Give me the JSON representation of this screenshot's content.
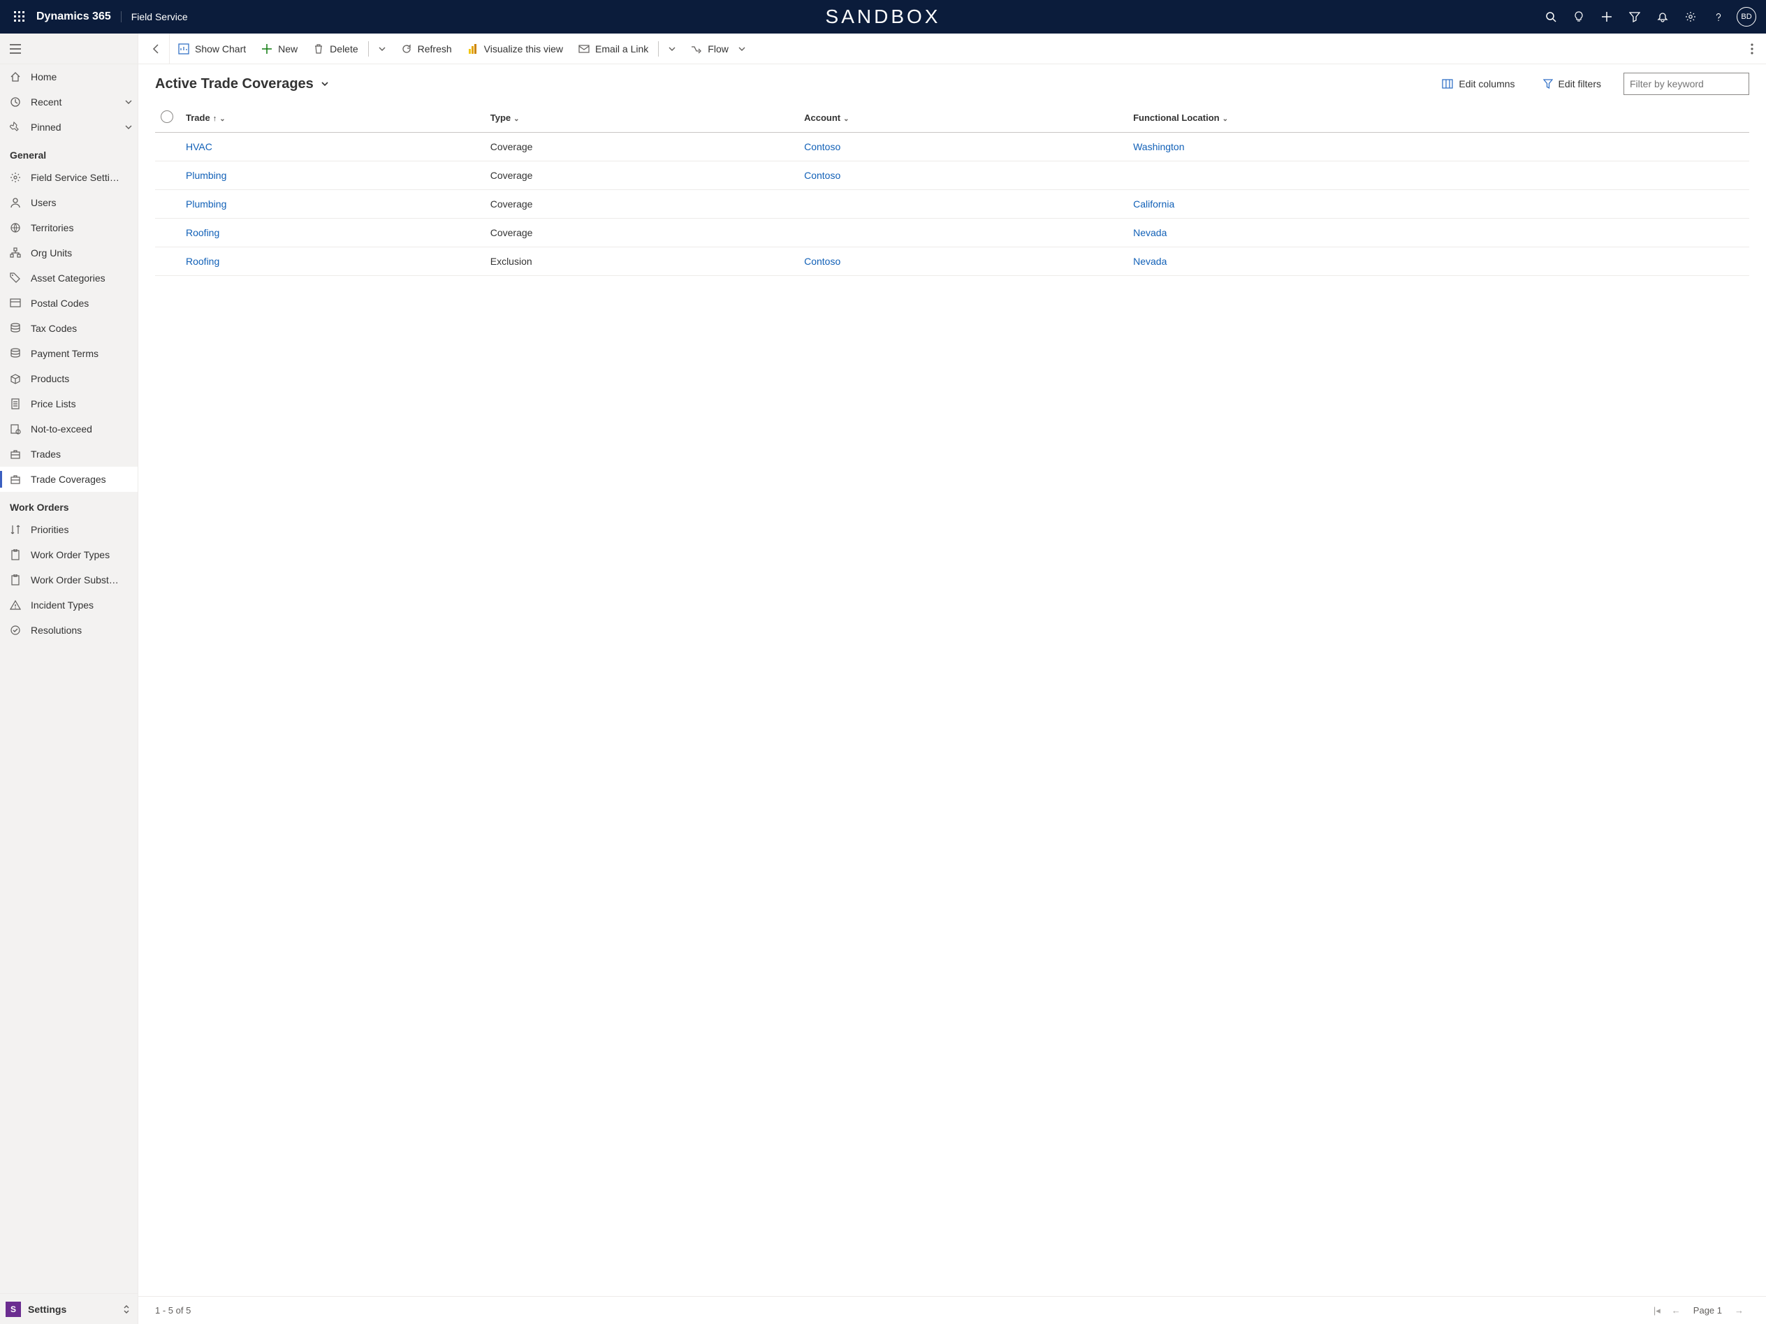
{
  "topnav": {
    "brand": "Dynamics 365",
    "app": "Field Service",
    "env": "SANDBOX",
    "avatar": "BD"
  },
  "sidebar": {
    "pinned_items": [
      {
        "id": "home",
        "icon": "home",
        "label": "Home"
      },
      {
        "id": "recent",
        "icon": "clock",
        "label": "Recent",
        "expandable": true
      },
      {
        "id": "pinned",
        "icon": "pin",
        "label": "Pinned",
        "expandable": true
      }
    ],
    "sections": [
      {
        "title": "General",
        "items": [
          {
            "id": "fss",
            "icon": "gear",
            "label": "Field Service Setti…"
          },
          {
            "id": "users",
            "icon": "person",
            "label": "Users"
          },
          {
            "id": "terr",
            "icon": "globe",
            "label": "Territories"
          },
          {
            "id": "org",
            "icon": "org",
            "label": "Org Units"
          },
          {
            "id": "asset",
            "icon": "tag",
            "label": "Asset Categories"
          },
          {
            "id": "postal",
            "icon": "postal",
            "label": "Postal Codes"
          },
          {
            "id": "tax",
            "icon": "stack",
            "label": "Tax Codes"
          },
          {
            "id": "pay",
            "icon": "stack",
            "label": "Payment Terms"
          },
          {
            "id": "prod",
            "icon": "box",
            "label": "Products"
          },
          {
            "id": "price",
            "icon": "sheet",
            "label": "Price Lists"
          },
          {
            "id": "nte",
            "icon": "nte",
            "label": "Not-to-exceed"
          },
          {
            "id": "trades",
            "icon": "case",
            "label": "Trades"
          },
          {
            "id": "tcov",
            "icon": "case",
            "label": "Trade Coverages",
            "selected": true
          }
        ]
      },
      {
        "title": "Work Orders",
        "items": [
          {
            "id": "prio",
            "icon": "sort",
            "label": "Priorities"
          },
          {
            "id": "wot",
            "icon": "clip",
            "label": "Work Order Types"
          },
          {
            "id": "wos",
            "icon": "clip",
            "label": "Work Order Subst…"
          },
          {
            "id": "inc",
            "icon": "warn",
            "label": "Incident Types"
          },
          {
            "id": "res",
            "icon": "check",
            "label": "Resolutions"
          }
        ]
      }
    ],
    "area": {
      "initial": "S",
      "label": "Settings"
    }
  },
  "commandbar": {
    "show_chart": "Show Chart",
    "new": "New",
    "delete": "Delete",
    "refresh": "Refresh",
    "visualize": "Visualize this view",
    "email": "Email a Link",
    "flow": "Flow"
  },
  "view": {
    "title": "Active Trade Coverages",
    "edit_columns": "Edit columns",
    "edit_filters": "Edit filters",
    "filter_placeholder": "Filter by keyword"
  },
  "grid": {
    "columns": [
      {
        "id": "trade",
        "label": "Trade",
        "sorted": "asc"
      },
      {
        "id": "type",
        "label": "Type"
      },
      {
        "id": "account",
        "label": "Account"
      },
      {
        "id": "funcloc",
        "label": "Functional Location"
      }
    ],
    "rows": [
      {
        "trade": "HVAC",
        "type": "Coverage",
        "account": "Contoso",
        "funcloc": "Washington"
      },
      {
        "trade": "Plumbing",
        "type": "Coverage",
        "account": "Contoso",
        "funcloc": ""
      },
      {
        "trade": "Plumbing",
        "type": "Coverage",
        "account": "",
        "funcloc": "California"
      },
      {
        "trade": "Roofing",
        "type": "Coverage",
        "account": "",
        "funcloc": "Nevada"
      },
      {
        "trade": "Roofing",
        "type": "Exclusion",
        "account": "Contoso",
        "funcloc": "Nevada"
      }
    ]
  },
  "footer": {
    "count_text": "1 - 5 of 5",
    "page_text": "Page 1"
  }
}
